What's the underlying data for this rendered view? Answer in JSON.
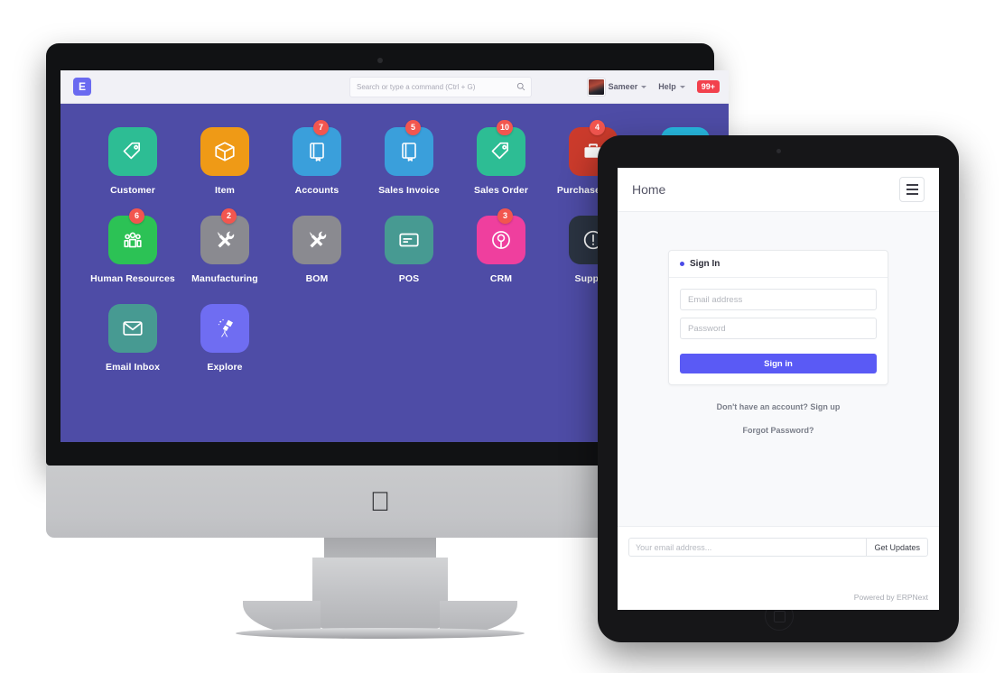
{
  "desktop": {
    "navbar": {
      "logo_letter": "E",
      "search_placeholder": "Search or type a command (Ctrl + G)",
      "search_value": "",
      "search_icon": "search-icon",
      "user_name": "Sameer",
      "help_label": "Help",
      "notification_count": "99+"
    },
    "apps": [
      {
        "label": "Customer",
        "icon": "tag-icon",
        "color": "#2dbd94",
        "badge": ""
      },
      {
        "label": "Item",
        "icon": "box-icon",
        "color": "#ef9a16",
        "badge": ""
      },
      {
        "label": "Accounts",
        "icon": "book-icon",
        "color": "#3a9fdb",
        "badge": "7"
      },
      {
        "label": "Sales Invoice",
        "icon": "book-icon",
        "color": "#3a9fdb",
        "badge": "5"
      },
      {
        "label": "Sales Order",
        "icon": "tag-icon",
        "color": "#2dbd94",
        "badge": "10"
      },
      {
        "label": "Purchase Order",
        "icon": "briefcase-icon",
        "color": "#cc3b2c",
        "badge": "4"
      },
      {
        "label": "",
        "icon": "cyan-app-icon",
        "color": "#27b9e0",
        "badge": ""
      },
      {
        "label": "Human Resources",
        "icon": "people-icon",
        "color": "#2cc255",
        "badge": "6"
      },
      {
        "label": "Manufacturing",
        "icon": "tools-icon",
        "color": "#8a8a90",
        "badge": "2"
      },
      {
        "label": "BOM",
        "icon": "tools-icon",
        "color": "#8a8a90",
        "badge": ""
      },
      {
        "label": "POS",
        "icon": "card-icon",
        "color": "#479a92",
        "badge": ""
      },
      {
        "label": "CRM",
        "icon": "broadcast-icon",
        "color": "#ef3f9e",
        "badge": "3"
      },
      {
        "label": "Support",
        "icon": "exclamation-icon",
        "color": "#2b3442",
        "badge": ""
      },
      {
        "label": "",
        "icon": "hidden-app-icon",
        "color": "#4e4ca6",
        "badge": ""
      },
      {
        "label": "Email Inbox",
        "icon": "envelope-icon",
        "color": "#479a92",
        "badge": ""
      },
      {
        "label": "Explore",
        "icon": "telescope-icon",
        "color": "#6f6df2",
        "badge": ""
      }
    ]
  },
  "tablet": {
    "site_nav": {
      "title": "Home",
      "menu_icon": "hamburger-icon"
    },
    "signin": {
      "card_title": "Sign In",
      "email_placeholder": "Email address",
      "email_value": "",
      "password_placeholder": "Password",
      "password_value": "",
      "submit_label": "Sign in",
      "signup_text": "Don't have an account? Sign up",
      "forgot_text": "Forgot Password?"
    },
    "footer": {
      "subscribe_placeholder": "Your email address...",
      "subscribe_value": "",
      "subscribe_button": "Get Updates",
      "powered_by": "Powered by ERPNext"
    }
  },
  "colors": {
    "desk_background": "#4e4ca6",
    "accent": "#5a5af5",
    "badge_red": "#f2564f",
    "navbar_badge_red": "#f2414d"
  }
}
